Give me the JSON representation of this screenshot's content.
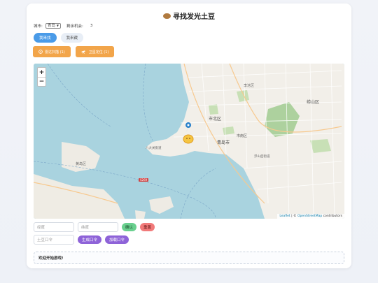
{
  "app": {
    "title": "寻找发光土豆"
  },
  "info": {
    "city_label": "城市:",
    "city_value": "青岛",
    "remaining_label": "剩余机会:",
    "remaining_value": "3"
  },
  "tabs": [
    {
      "label": "我来找",
      "active": true
    },
    {
      "label": "我来藏",
      "active": false
    }
  ],
  "actions": {
    "scan_label": "雷达扫描 (1)",
    "telescope_label": "卫星定位 (1)"
  },
  "map": {
    "zoom_in": "+",
    "zoom_out": "−",
    "attribution_leaflet": "Leaflet",
    "attribution_sep": " | © ",
    "attribution_osm": "OpenStreetMap",
    "attribution_rest": " contributors",
    "labels": {
      "shinan": "市南区",
      "shibei": "市北区",
      "licang": "李沧区",
      "laoshan": "崂山区",
      "qingdao_city": "青岛市",
      "badaguan": "八大关街道",
      "fushan": "浮山后街道",
      "jiaozhou": "黄岛区",
      "route": "S269"
    }
  },
  "controls": {
    "longitude_placeholder": "经度",
    "latitude_placeholder": "纬度",
    "confirm_label": "确认",
    "reset_label": "重置",
    "code_placeholder": "土豆口令",
    "generate_label": "生成口令",
    "join_label": "加载口令"
  },
  "message": "欢迎开始游戏!",
  "colors": {
    "primary": "#4a9be8",
    "orange": "#f2a54a",
    "green": "#6ad08f",
    "red": "#f17a7a",
    "purple": "#8e63d8",
    "sea": "#a9d3df"
  }
}
